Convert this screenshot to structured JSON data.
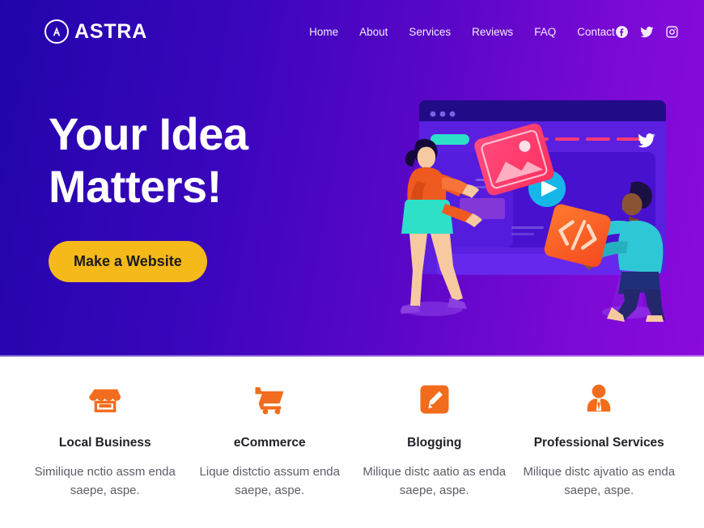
{
  "brand": {
    "name": "ASTRA",
    "logo_icon": "astra-circle-a-logo"
  },
  "nav": {
    "items": [
      {
        "label": "Home"
      },
      {
        "label": "About"
      },
      {
        "label": "Services"
      },
      {
        "label": "Reviews"
      },
      {
        "label": "FAQ"
      },
      {
        "label": "Contact"
      }
    ]
  },
  "social": {
    "items": [
      {
        "icon": "facebook-icon",
        "label": "Facebook"
      },
      {
        "icon": "twitter-icon",
        "label": "Twitter"
      },
      {
        "icon": "instagram-icon",
        "label": "Instagram"
      }
    ]
  },
  "hero": {
    "title_line1": "Your Idea",
    "title_line2": "Matters!",
    "cta_label": "Make a Website",
    "illustration": "two-people-building-website-illustration",
    "bg_gradient_from": "#2105ab",
    "bg_gradient_to": "#8a0bdc",
    "cta_color": "#f5b919",
    "cta_text_color": "#1b1b1b"
  },
  "features": {
    "accent_color": "#f26c1d",
    "items": [
      {
        "icon": "store-icon",
        "title": "Local Business",
        "desc": "Similique nctio assm enda saepe, aspe."
      },
      {
        "icon": "shopping-cart-icon",
        "title": "eCommerce",
        "desc": "Lique distctio assum enda saepe, aspe."
      },
      {
        "icon": "pencil-edit-icon",
        "title": "Blogging",
        "desc": "Milique distc aatio as enda saepe, aspe."
      },
      {
        "icon": "businessperson-icon",
        "title": "Professional Services",
        "desc": "Milique distc ajvatio as enda saepe, aspe."
      }
    ]
  }
}
